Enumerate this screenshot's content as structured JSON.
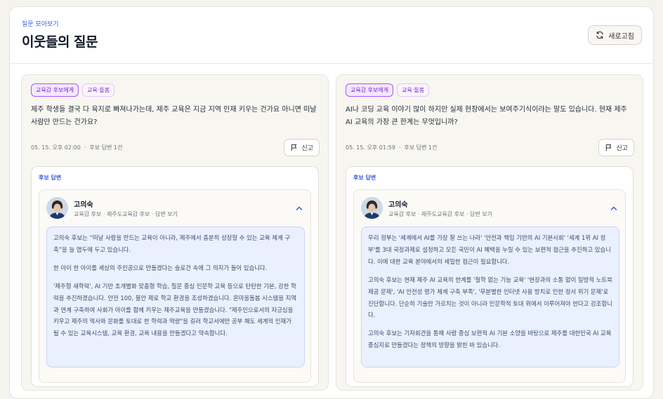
{
  "header": {
    "eyebrow": "질문 모아보기",
    "title": "이웃들의 질문",
    "refresh_label": "새로고침",
    "refresh_icon": "refresh-icon"
  },
  "colors": {
    "accent": "#3b5bdb",
    "tag": "#7e22ce",
    "answer_bg": "#eaf0fd"
  },
  "cards": [
    {
      "tags": [
        "교육감 후보에게",
        "교육·돌봄"
      ],
      "question": "제주 학생들 결국 다 육지로 빠져나가는데, 제주 교육은 지금 지역 인재 키우는 건가요 아니면 떠날 사람만 만드는 건가요?",
      "date": "05. 15. 오후 02:00",
      "answer_status": "후보 답변 1건",
      "report_label": "신고",
      "answer_label": "후보 답변",
      "candidate": {
        "name": "고의숙",
        "subtitle": "교육감 후보 · 제주도교육감 후보 · 답변 보기"
      },
      "answer_paragraphs": [
        "고의숙 후보는 “떠날 사람을 만드는 교육이 아니라, 제주에서 충분히 성장할 수 있는 교육 체계 구축”을 늘 염두에 두고 있습니다.",
        "한 아이 한 아이를 세상의 주인공으로 만들겠다는 슬로건 속에 그 의지가 들어 있습니다.",
        "'제주형 새학력', AI 기반 초개별화 맞춤형 학습, 질문 중심 인문학 교육 등으로 탄탄한 기본, 강한 학력을 추진하겠습니다. 안전 100, 불안 제로 학교 환경을 조성하겠습니다. 온마을돌봄 시스템을 지역과 연계 구축하여 사회가 아이를 함께 키우는 제주교육을 만들겠습니다. \"제주인으로서의 자긍심을 키우고 제주의 역사와 문화를 토대로 한 학력과 역량\"을 길러 학교서에만 공부 해도 세계의 인재가 될 수 있는 교육시스템, 교육 환경, 교육 내용을 만들겠다고 약속합니다."
      ]
    },
    {
      "tags": [
        "교육감 후보에게",
        "교육·돌봄"
      ],
      "question": "AI나 코딩 교육 이야기 많이 하지만 실제 현장에서는 보여주기식이라는 말도 있습니다. 현재 제주 AI 교육의 가장 큰 한계는 무엇입니까?",
      "date": "05. 15. 오후 01:59",
      "answer_status": "후보 답변 1건",
      "report_label": "신고",
      "answer_label": "후보 답변",
      "candidate": {
        "name": "고의숙",
        "subtitle": "교육감 후보 · 제주도교육감 후보 · 답변 보기"
      },
      "answer_paragraphs": [
        "우리 정부는 '세계에서 AI를 가장 잘 쓰는 나라' '안전과 책임 기반의 AI 기본사회' '세계 1위 AI 정부'를 3대 국정과제로 설정하고 모든 국민이 AI 혜택을 누릴 수 있는 보편적 접근을 추진하고 있습니다. 이에 대한 교육 분야에서의 세밀한 접근이 필요합니다.",
        "고의숙 후보는 현재 제주 AI 교육의 한계를 '철학 없는 기능 교육' '현장과의 소통 없이 일방적 노트북 제공 문제', 'AI 안전성 평가 체계 구축 부족', '무분별한 인터넷 사용 방치로 인한 정서 위기 문제'로 진단합니다. 단순히 기술만 가르치는 것이 아니라 인문학적 토대 위에서 이루어져야 한다고 강조합니다.",
        "고의숙 후보는 기자회견을 통해 사람 중심 보편적 AI 기본 소양을 바탕으로 제주를 대한민국 AI 교육 중심지로 만들겠다는 정책의 방향을 밝힌 바 있습니다."
      ]
    }
  ]
}
